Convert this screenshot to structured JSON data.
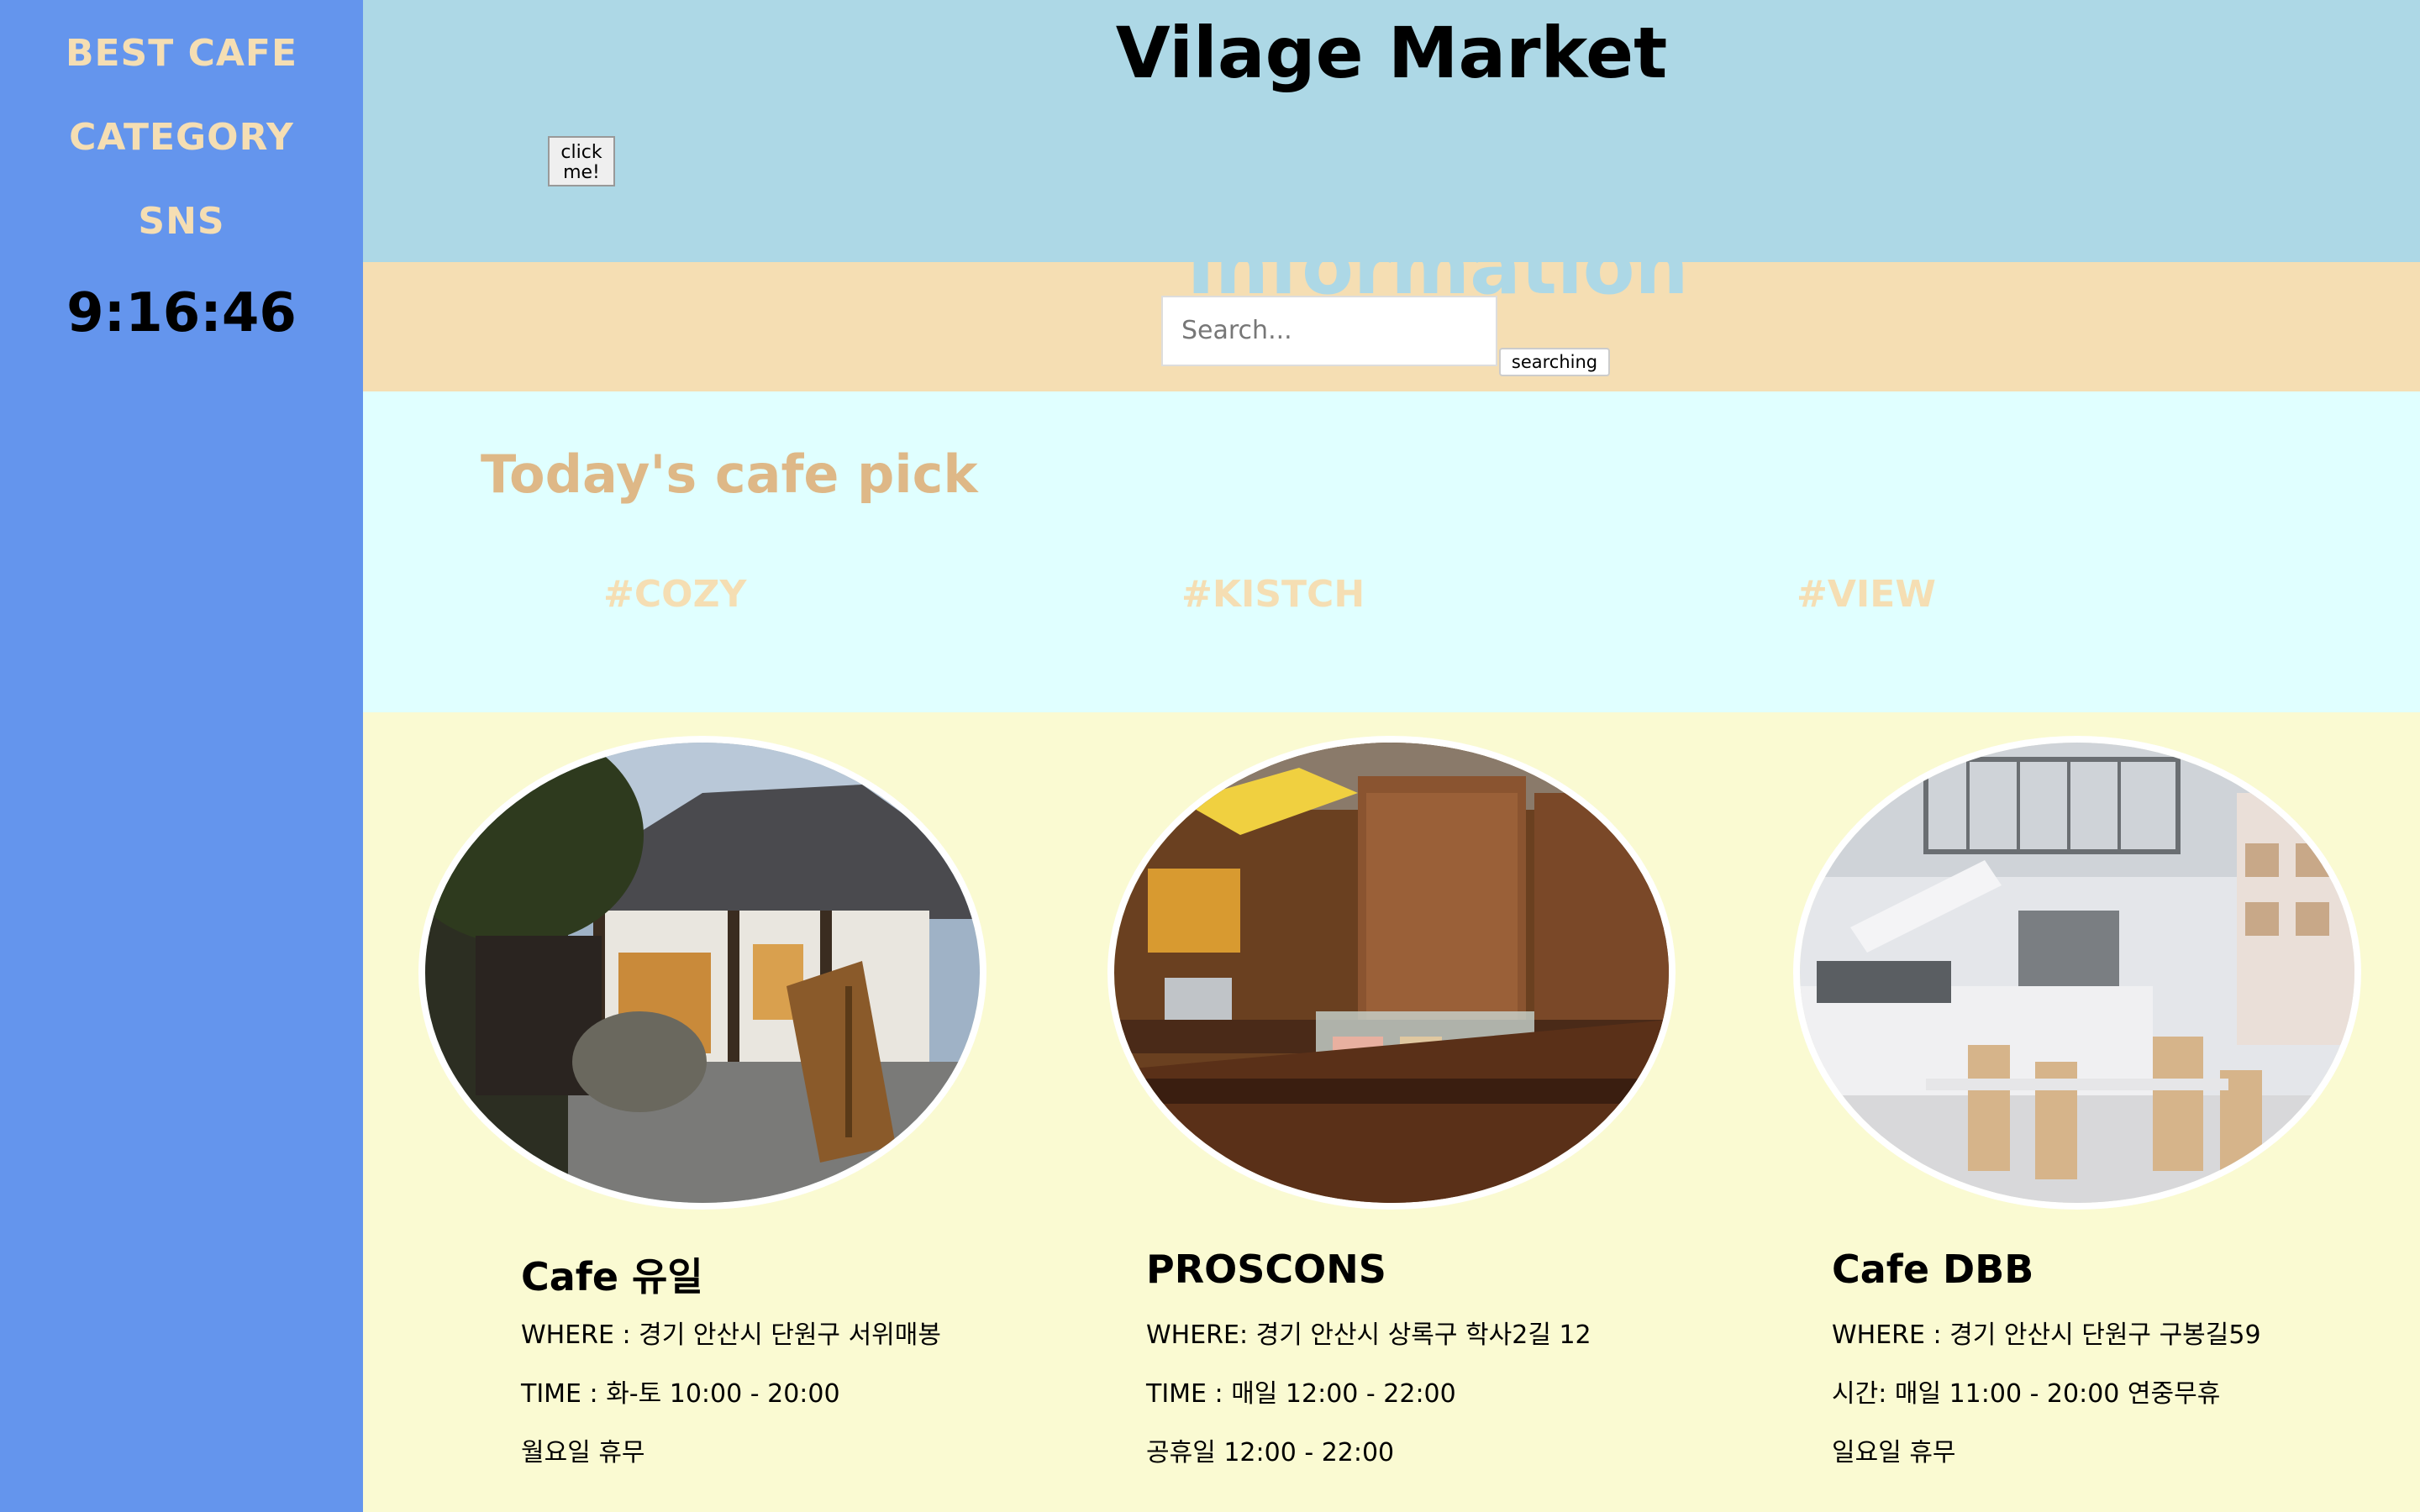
{
  "sidebar": {
    "items": [
      {
        "label": "BEST CAFE"
      },
      {
        "label": "CATEGORY"
      },
      {
        "label": "SNS"
      }
    ],
    "clock": "9:16:46"
  },
  "header": {
    "title": "Vilage Market",
    "click_button": "click me!"
  },
  "info": {
    "heading": "Information",
    "search_placeholder": "Search...",
    "search_button": "searching"
  },
  "pick": {
    "heading": "Today's cafe pick",
    "tags": [
      "#COZY",
      "#KISTCH",
      "#VIEW"
    ]
  },
  "cafes": [
    {
      "name": "Cafe 유일",
      "lines": [
        "WHERE : 경기 안산시 단원구 서위매봉",
        "TIME : 화-토 10:00 - 20:00",
        "월요일 휴무"
      ]
    },
    {
      "name": "PROSCONS",
      "lines": [
        "WHERE: 경기 안산시 상록구 학사2길 12",
        "TIME : 매일 12:00 - 22:00",
        "공휴일 12:00 - 22:00"
      ]
    },
    {
      "name": "Cafe DBB",
      "lines": [
        "WHERE : 경기 안산시 단원구 구봉길59",
        "시간: 매일 11:00 - 20:00 연중무휴",
        "일요일 휴무"
      ]
    }
  ],
  "colors": {
    "sidebar": "#6495ed",
    "header": "#add8e6",
    "info_band": "#f5deb3",
    "pick_band": "#e0ffff",
    "cafes_band": "#fafad2",
    "accent": "#deb887"
  }
}
